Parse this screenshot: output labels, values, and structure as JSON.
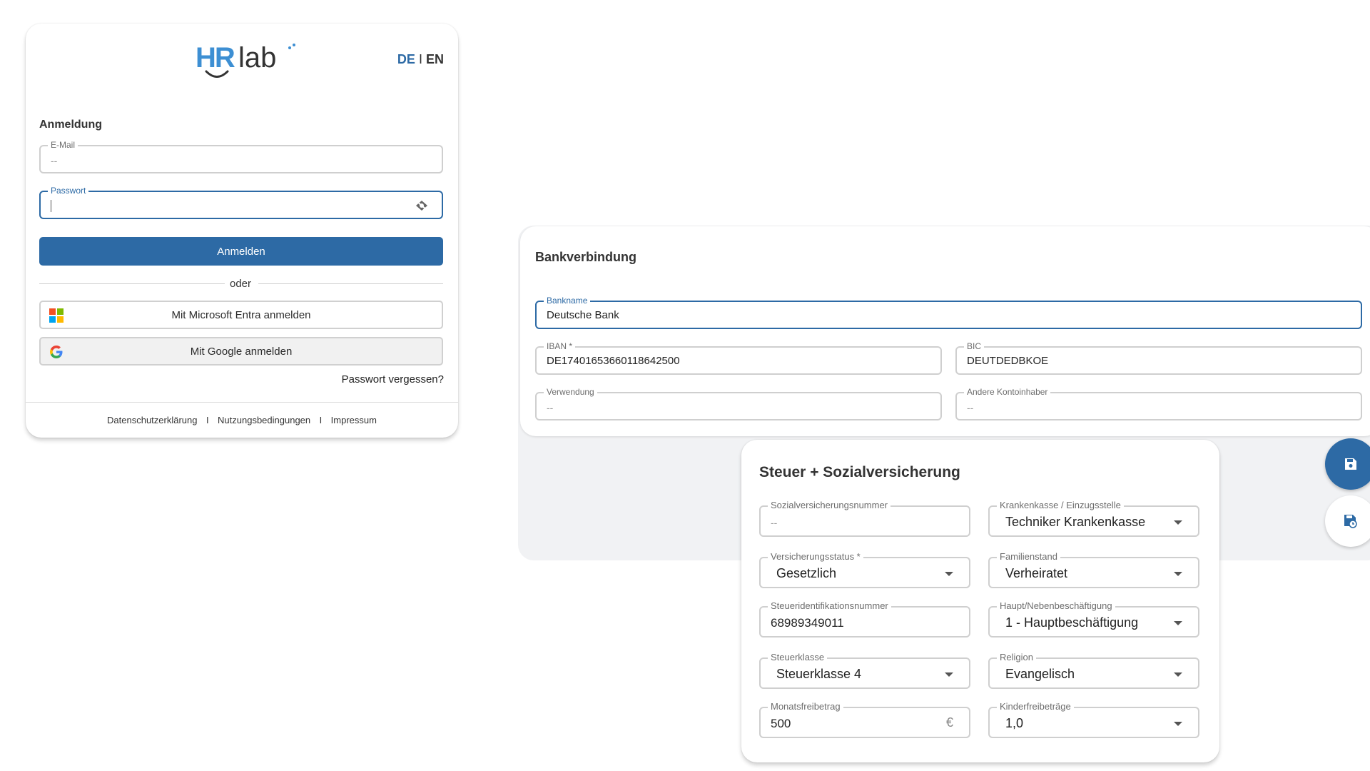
{
  "login": {
    "logo_text_hr": "HR",
    "logo_text_lab": "lab",
    "lang_de": "DE",
    "lang_sep": "I",
    "lang_en": "EN",
    "heading": "Anmeldung",
    "email_label": "E-Mail",
    "email_value": "--",
    "password_label": "Passwort",
    "submit_label": "Anmelden",
    "divider_text": "oder",
    "microsoft_label": "Mit Microsoft Entra anmelden",
    "google_label": "Mit Google anmelden",
    "forgot_label": "Passwort vergessen?",
    "footer": {
      "privacy": "Datenschutzerklärung",
      "sep1": "I",
      "terms": "Nutzungsbedingungen",
      "sep2": "I",
      "imprint": "Impressum"
    }
  },
  "bank": {
    "heading": "Bankverbindung",
    "bankname_label": "Bankname",
    "bankname_value": "Deutsche Bank",
    "iban_label": "IBAN *",
    "iban_value": "DE17401653660118642500",
    "bic_label": "BIC",
    "bic_value": "DEUTDEDBKOE",
    "usage_label": "Verwendung",
    "usage_value": "--",
    "other_holder_label": "Andere Kontoinhaber",
    "other_holder_value": "--"
  },
  "tax": {
    "heading": "Steuer + Sozialversicherung",
    "ssn_label": "Sozialversicherungsnummer",
    "ssn_value": "--",
    "insurer_label": "Krankenkasse / Einzugsstelle",
    "insurer_value": "Techniker Krankenkasse",
    "ins_status_label": "Versicherungsstatus *",
    "ins_status_value": "Gesetzlich",
    "marital_label": "Familienstand",
    "marital_value": "Verheiratet",
    "taxid_label": "Steueridentifikationsnummer",
    "taxid_value": "68989349011",
    "employment_label": "Haupt/Nebenbeschäftigung",
    "employment_value": "1 - Hauptbeschäftigung",
    "taxclass_label": "Steuerklasse",
    "taxclass_value": "Steuerklasse 4",
    "religion_label": "Religion",
    "religion_value": "Evangelisch",
    "monthly_label": "Monatsfreibetrag",
    "monthly_value": "500",
    "monthly_unit": "€",
    "child_label": "Kinderfreibeträge",
    "child_value": "1,0"
  },
  "colors": {
    "primary": "#2d6aa5",
    "fab": "#2d6aa5",
    "panel_bg": "#f1f2f4"
  }
}
